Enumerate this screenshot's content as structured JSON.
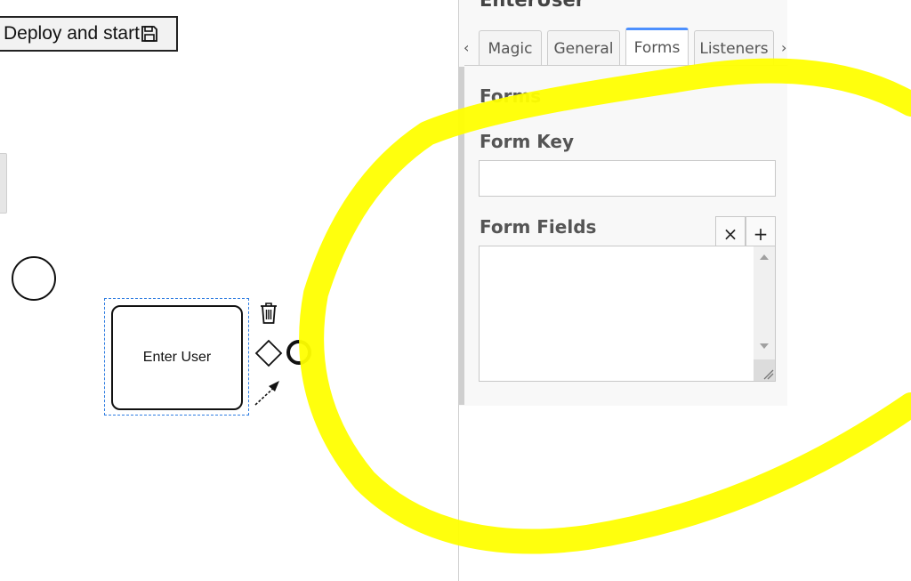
{
  "canvas": {
    "deploy_label": "Deploy and start",
    "save_icon": "floppy-disk-icon",
    "task_label": "Enter User",
    "context_pad": [
      "trash-icon",
      "gateway-diamond-icon",
      "end-event-icon",
      "connect-arrow-icon"
    ]
  },
  "properties_panel": {
    "title": "EnterUser",
    "tabs": [
      {
        "label": "Magic",
        "active": false
      },
      {
        "label": "General",
        "active": false
      },
      {
        "label": "Forms",
        "active": true
      },
      {
        "label": "Listeners",
        "active": false
      }
    ],
    "tab_prev": "‹",
    "tab_next": "›",
    "section_title": "Forms",
    "form_key": {
      "label": "Form Key",
      "value": ""
    },
    "form_fields": {
      "label": "Form Fields",
      "remove_label": "×",
      "add_label": "+",
      "items": []
    }
  },
  "colors": {
    "annotation": "#ffff00",
    "selection": "#2f7de1",
    "active_tab": "#4d90fe"
  }
}
